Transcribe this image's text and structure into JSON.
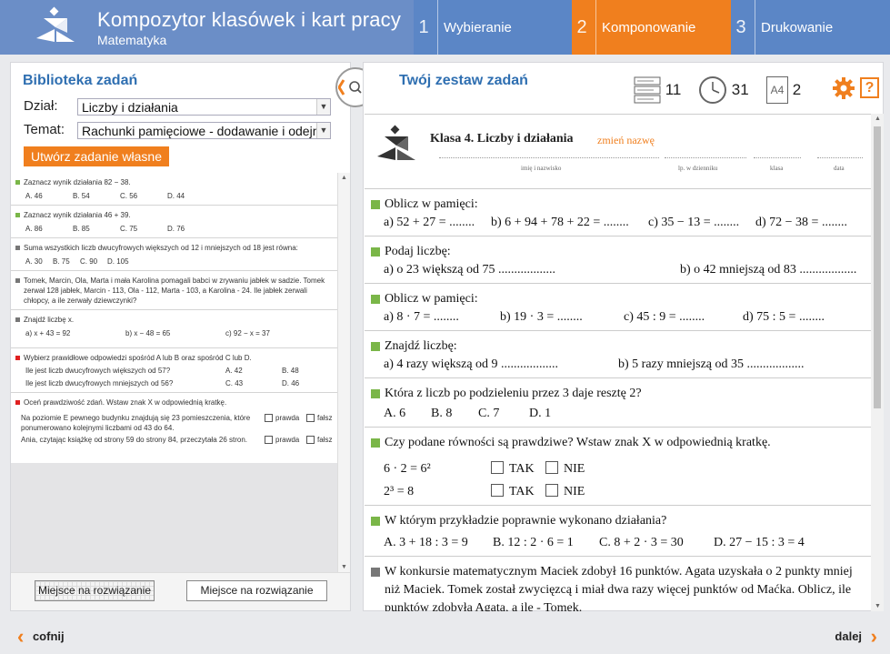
{
  "header": {
    "title": "Kompozytor klasówek i kart pracy",
    "subtitle": "Matematyka",
    "steps": [
      {
        "num": "1",
        "label": "Wybieranie"
      },
      {
        "num": "2",
        "label": "Komponowanie"
      },
      {
        "num": "3",
        "label": "Drukowanie"
      }
    ],
    "colors": {
      "bar": "#6b8ec7",
      "step": "#5b86c6",
      "active": "#f07f1e"
    }
  },
  "library": {
    "title": "Biblioteka zadań",
    "section_label": "Dział:",
    "section_value": "Liczby i działania",
    "topic_label": "Temat:",
    "topic_value": "Rachunki pamięciowe - dodawanie i odejmow",
    "own_task_button": "Utwórz zadanie własne",
    "tasks": [
      {
        "q": "Zaznacz wynik działania 82 − 38.",
        "opts": [
          "A. 46",
          "B. 54",
          "C. 56",
          "D. 44"
        ]
      },
      {
        "q": "Zaznacz wynik działania 46 + 39.",
        "opts": [
          "A. 86",
          "B. 85",
          "C. 75",
          "D. 76"
        ]
      },
      {
        "q": "Suma wszystkich liczb dwucyfrowych większych od 12 i mniejszych od 18 jest równa:",
        "opts": [
          "A. 30",
          "B. 75",
          "C. 90",
          "D. 105"
        ]
      },
      {
        "q": "Tomek, Marcin, Ola, Marta i mała Karolina pomagali babci w zrywaniu jabłek w sadzie. Tomek zerwał 128 jabłek, Marcin - 113, Ola - 112, Marta - 103, a Karolina - 24. Ile jabłek zerwali chłopcy, a ile zerwały dziewczynki?"
      },
      {
        "q": "Znajdź liczbę x.",
        "opts": [
          "a) x + 43 = 92",
          "b) x − 48 = 65",
          "c) 92 − x = 37"
        ]
      },
      {
        "q": "Wybierz prawidłowe odpowiedzi spośród A lub B oraz spośród C lub D.",
        "lines": [
          {
            "text": "Ile jest liczb dwucyfrowych większych od 57?",
            "a": "A. 42",
            "b": "B. 48"
          },
          {
            "text": "Ile jest liczb dwucyfrowych mniejszych od 56?",
            "a": "C. 43",
            "b": "D. 46"
          }
        ]
      },
      {
        "q": "Oceń prawdziwość zdań. Wstaw znak X w odpowiednią kratkę.",
        "sentences": [
          "Na poziomie E pewnego budynku znajdują się 23 pomieszczenia, które ponumerowano kolejnymi liczbami od 43 do 64.",
          "Ania, czytając książkę od strony 59 do strony 84, przeczytała 26 stron."
        ],
        "true_label": "prawda",
        "false_label": "fałsz"
      }
    ],
    "space_btn1": "Miejsce na rozwiązanie",
    "space_btn2": "Miejsce na rozwiązanie"
  },
  "set": {
    "title": "Twój zestaw zadań",
    "task_count": "11",
    "time_minutes": "31",
    "paper_format": "A4",
    "pages": "2",
    "help": "?"
  },
  "doc": {
    "title": "Klasa 4. Liczby i działania",
    "rename": "zmień nazwę",
    "fields": [
      "imię i nazwisko",
      "lp. w dzienniku",
      "klasa",
      "data"
    ],
    "tasks": [
      {
        "q": "Oblicz w pamięci:",
        "items": [
          "a) 52 + 27 = ........",
          "b) 6 + 94 + 78 + 22 = ........",
          "c) 35 − 13 = ........",
          "d) 72 − 38 = ........"
        ]
      },
      {
        "q": "Podaj liczbę:",
        "items": [
          "a) o 23 większą od 75 ..................",
          "b) o 42 mniejszą od 83 .................."
        ]
      },
      {
        "q": "Oblicz w pamięci:",
        "items": [
          "a) 8 · 7 = ........",
          "b) 19 · 3 = ........",
          "c) 45 : 9 = ........",
          "d) 75 : 5 = ........"
        ]
      },
      {
        "q": "Znajdź liczbę:",
        "items": [
          "a) 4 razy większą od 9 ..................",
          "b) 5 razy mniejszą od 35 .................."
        ]
      },
      {
        "q": "Która z liczb po podzieleniu przez 3 daje resztę 2?",
        "items": [
          "A. 6",
          "B. 8",
          "C. 7",
          "D. 1"
        ]
      },
      {
        "q": "Czy podane równości są prawdziwe? Wstaw znak X w odpowiednią kratkę.",
        "rows": [
          "6 · 2 = 6²",
          "2³ = 8"
        ],
        "yes": "TAK",
        "no": "NIE"
      },
      {
        "q": "W którym przykładzie poprawnie wykonano działania?",
        "items": [
          "A. 3 + 18 : 3 = 9",
          "B. 12 : 2 · 6 = 1",
          "C. 8 + 2 · 3 = 30",
          "D. 27 − 15 : 3 = 4"
        ]
      },
      {
        "q": "W konkursie matematycznym Maciek zdobył 16 punktów. Agata uzyskała o 2 punkty mniej niż Maciek. Tomek został zwycięzcą i miał dwa razy więcej punktów od Maćka. Oblicz, ile punktów zdobyła Agata, a ile - Tomek."
      }
    ]
  },
  "footer": {
    "back": "cofnij",
    "next": "dalej"
  }
}
